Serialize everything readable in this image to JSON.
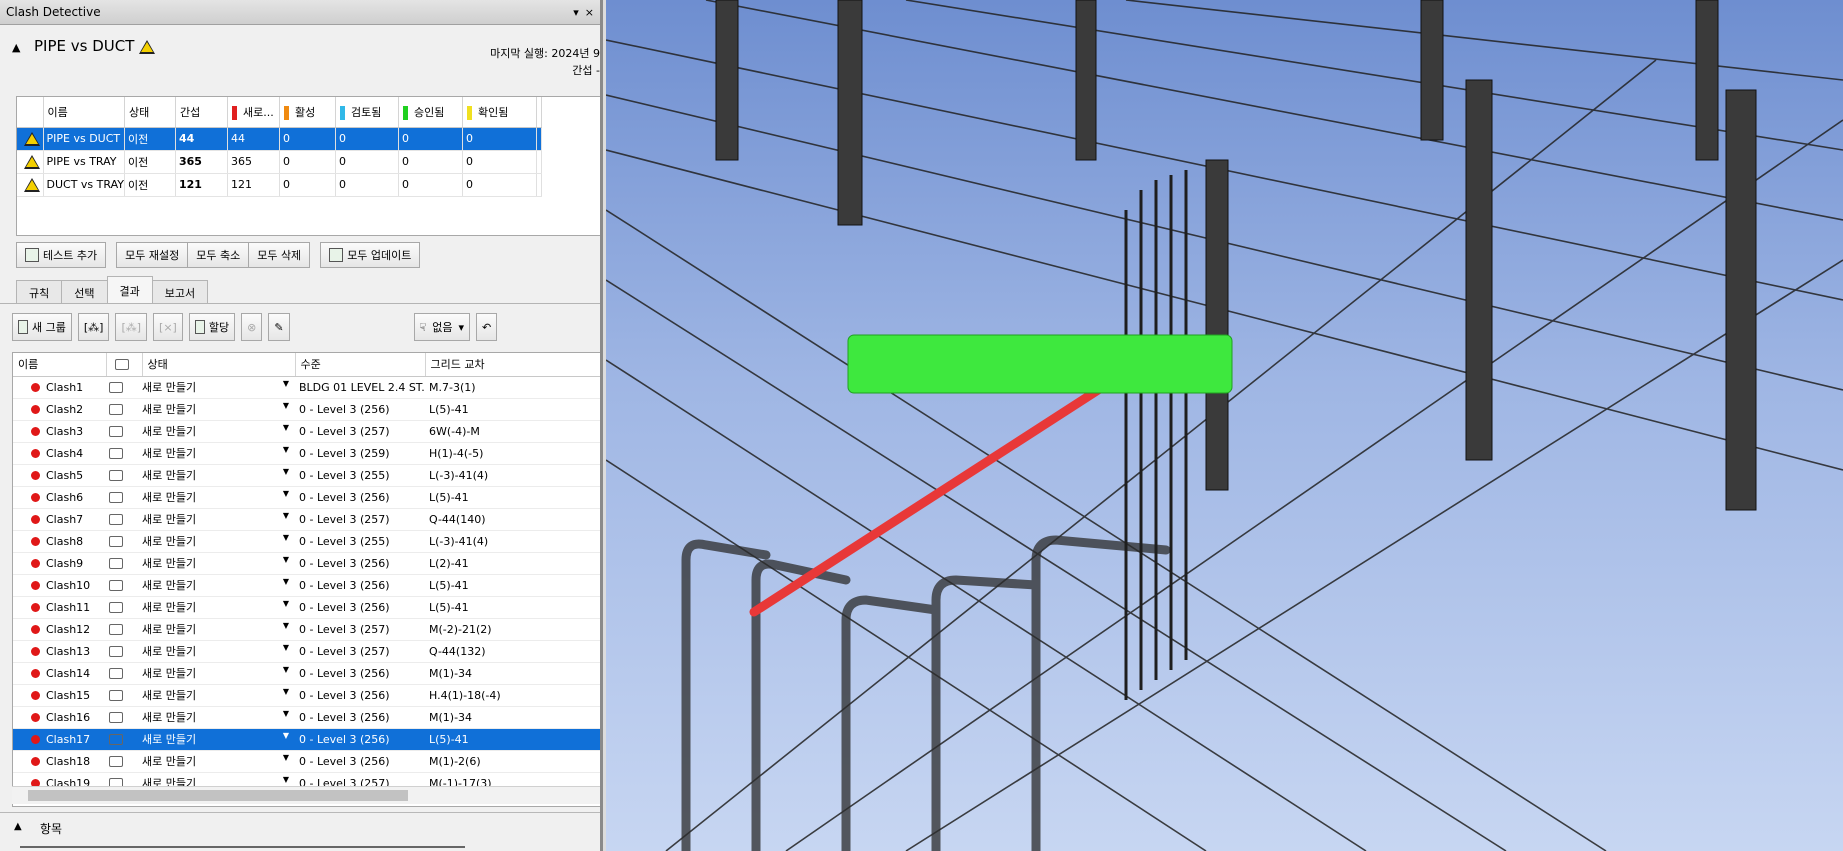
{
  "panel": {
    "title": "Clash Detective",
    "title_buttons": [
      "▾",
      "×"
    ],
    "test_name": "PIPE vs DUCT",
    "last_run": "마지막 실행:  2024년 9",
    "clashes_label": "간섭 -"
  },
  "tests": {
    "headers": [
      "이름",
      "상태",
      "간섭",
      "새로...",
      "활성",
      "검토됨",
      "승인됨",
      "확인됨"
    ],
    "header_colors": {
      "new": "#e02020",
      "active": "#f08a10",
      "reviewed": "#30b8e8",
      "approved": "#20d020",
      "resolved": "#f0e020"
    },
    "rows": [
      {
        "name": "PIPE vs DUCT",
        "status": "이전",
        "clashes": "44",
        "new": "44",
        "active": "0",
        "reviewed": "0",
        "approved": "0",
        "resolved": "0"
      },
      {
        "name": "PIPE vs TRAY",
        "status": "이전",
        "clashes": "365",
        "new": "365",
        "active": "0",
        "reviewed": "0",
        "approved": "0",
        "resolved": "0"
      },
      {
        "name": "DUCT vs TRAY",
        "status": "이전",
        "clashes": "121",
        "new": "121",
        "active": "0",
        "reviewed": "0",
        "approved": "0",
        "resolved": "0"
      }
    ]
  },
  "buttons": {
    "add_test": "테스트 추가",
    "reset_all": "모두 재설정",
    "compact_all": "모두 축소",
    "delete_all": "모두 삭제",
    "update_all": "모두 업데이트"
  },
  "tabs": [
    "규칙",
    "선택",
    "결과",
    "보고서"
  ],
  "toolbar": {
    "new_group": "새 그룹",
    "assign": "할당",
    "filter": "없음"
  },
  "results": {
    "headers": [
      "이름",
      "상태",
      "수준",
      "그리드 교차"
    ],
    "rows": [
      {
        "name": "Clash1",
        "status": "새로 만들기",
        "level": "BLDG 01 LEVEL 2.4 ST...",
        "grid": "M.7-3(1)"
      },
      {
        "name": "Clash2",
        "status": "새로 만들기",
        "level": "0 - Level 3 (256)",
        "grid": "L(5)-41"
      },
      {
        "name": "Clash3",
        "status": "새로 만들기",
        "level": "0 - Level 3 (257)",
        "grid": "6W(-4)-M"
      },
      {
        "name": "Clash4",
        "status": "새로 만들기",
        "level": "0 - Level 3 (259)",
        "grid": "H(1)-4(-5)"
      },
      {
        "name": "Clash5",
        "status": "새로 만들기",
        "level": "0 - Level 3 (255)",
        "grid": "L(-3)-41(4)"
      },
      {
        "name": "Clash6",
        "status": "새로 만들기",
        "level": "0 - Level 3 (256)",
        "grid": "L(5)-41"
      },
      {
        "name": "Clash7",
        "status": "새로 만들기",
        "level": "0 - Level 3 (257)",
        "grid": "Q-44(140)"
      },
      {
        "name": "Clash8",
        "status": "새로 만들기",
        "level": "0 - Level 3 (255)",
        "grid": "L(-3)-41(4)"
      },
      {
        "name": "Clash9",
        "status": "새로 만들기",
        "level": "0 - Level 3 (256)",
        "grid": "L(2)-41"
      },
      {
        "name": "Clash10",
        "status": "새로 만들기",
        "level": "0 - Level 3 (256)",
        "grid": "L(5)-41"
      },
      {
        "name": "Clash11",
        "status": "새로 만들기",
        "level": "0 - Level 3 (256)",
        "grid": "L(5)-41"
      },
      {
        "name": "Clash12",
        "status": "새로 만들기",
        "level": "0 - Level 3 (257)",
        "grid": "M(-2)-21(2)"
      },
      {
        "name": "Clash13",
        "status": "새로 만들기",
        "level": "0 - Level 3 (257)",
        "grid": "Q-44(132)"
      },
      {
        "name": "Clash14",
        "status": "새로 만들기",
        "level": "0 - Level 3 (256)",
        "grid": "M(1)-34"
      },
      {
        "name": "Clash15",
        "status": "새로 만들기",
        "level": "0 - Level 3 (256)",
        "grid": "H.4(1)-18(-4)"
      },
      {
        "name": "Clash16",
        "status": "새로 만들기",
        "level": "0 - Level 3 (256)",
        "grid": "M(1)-34"
      },
      {
        "name": "Clash17",
        "status": "새로 만들기",
        "level": "0 - Level 3 (256)",
        "grid": "L(5)-41"
      },
      {
        "name": "Clash18",
        "status": "새로 만들기",
        "level": "0 - Level 3 (256)",
        "grid": "M(1)-2(6)"
      },
      {
        "name": "Clash19",
        "status": "새로 만들기",
        "level": "0 - Level 3 (257)",
        "grid": "M(-1)-17(3)"
      }
    ],
    "selected": "Clash17"
  },
  "items_section": "항목",
  "viewport": {
    "background": "#8aa6de",
    "clash_pipe_color": "#e83838",
    "clash_duct_color": "#3ee83e"
  }
}
